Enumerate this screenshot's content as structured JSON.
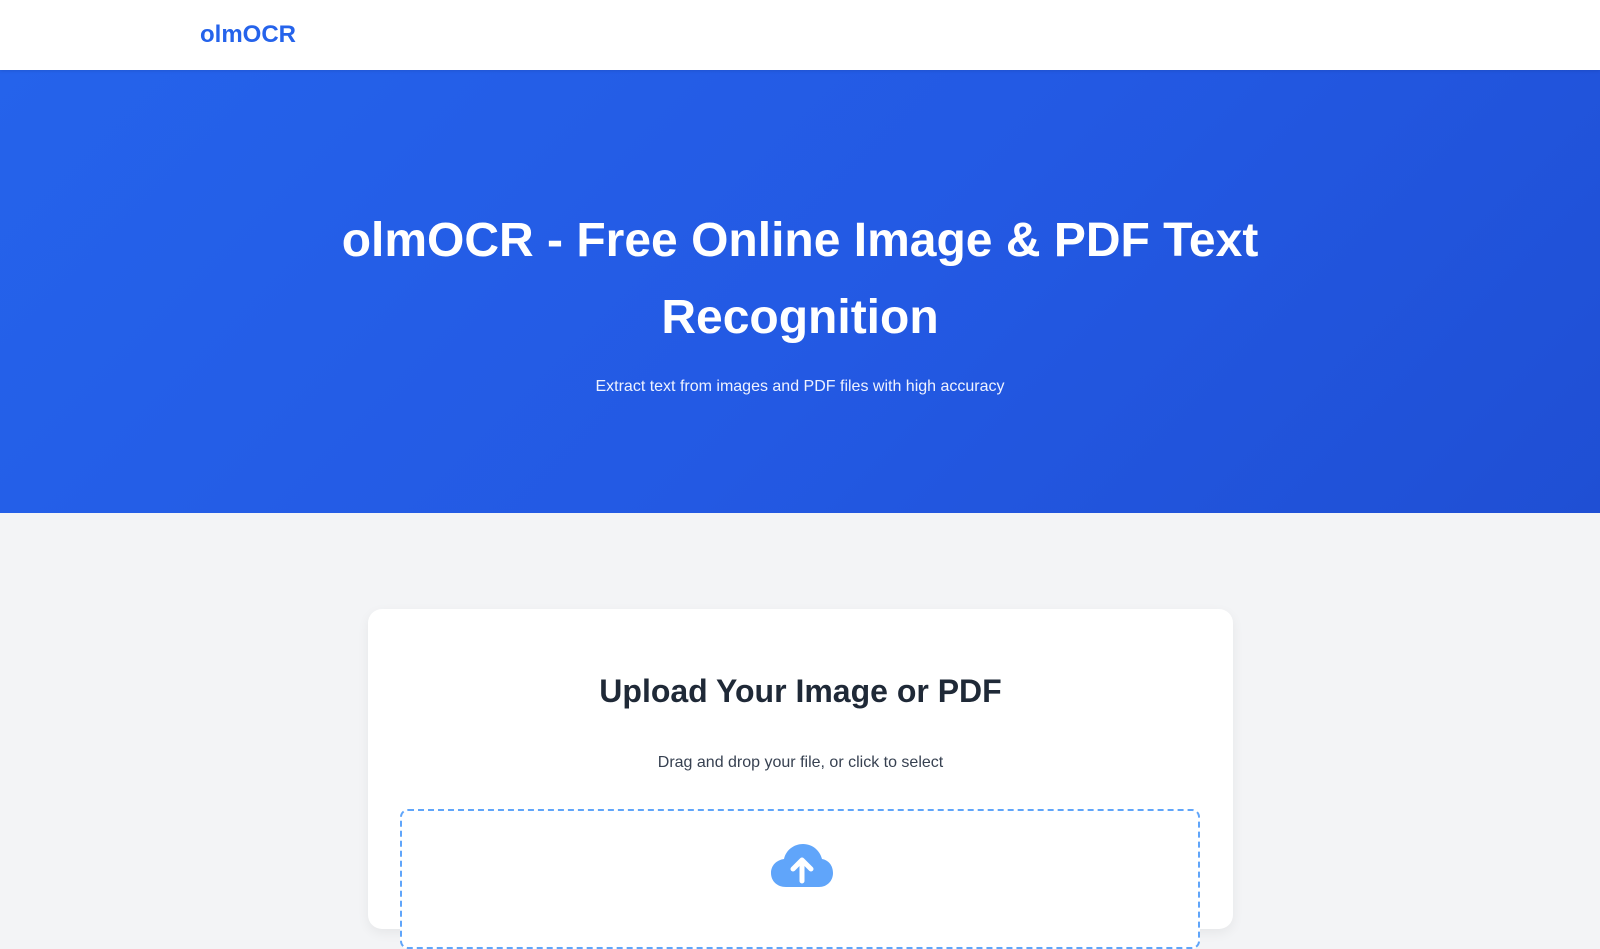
{
  "nav": {
    "brand": "olmOCR"
  },
  "hero": {
    "title": "olmOCR - Free Online Image & PDF Text Recognition",
    "subtitle": "Extract text from images and PDF files with high accuracy"
  },
  "upload": {
    "title": "Upload Your Image or PDF",
    "description": "Drag and drop your file, or click to select",
    "icon": "cloud-upload-icon"
  },
  "colors": {
    "brand": "#2563eb",
    "hero_start": "#2563eb",
    "hero_end": "#1f4fd4",
    "dropzone_border": "#60a5fa",
    "icon": "#60a5fa",
    "page_bg": "#f3f4f6"
  }
}
